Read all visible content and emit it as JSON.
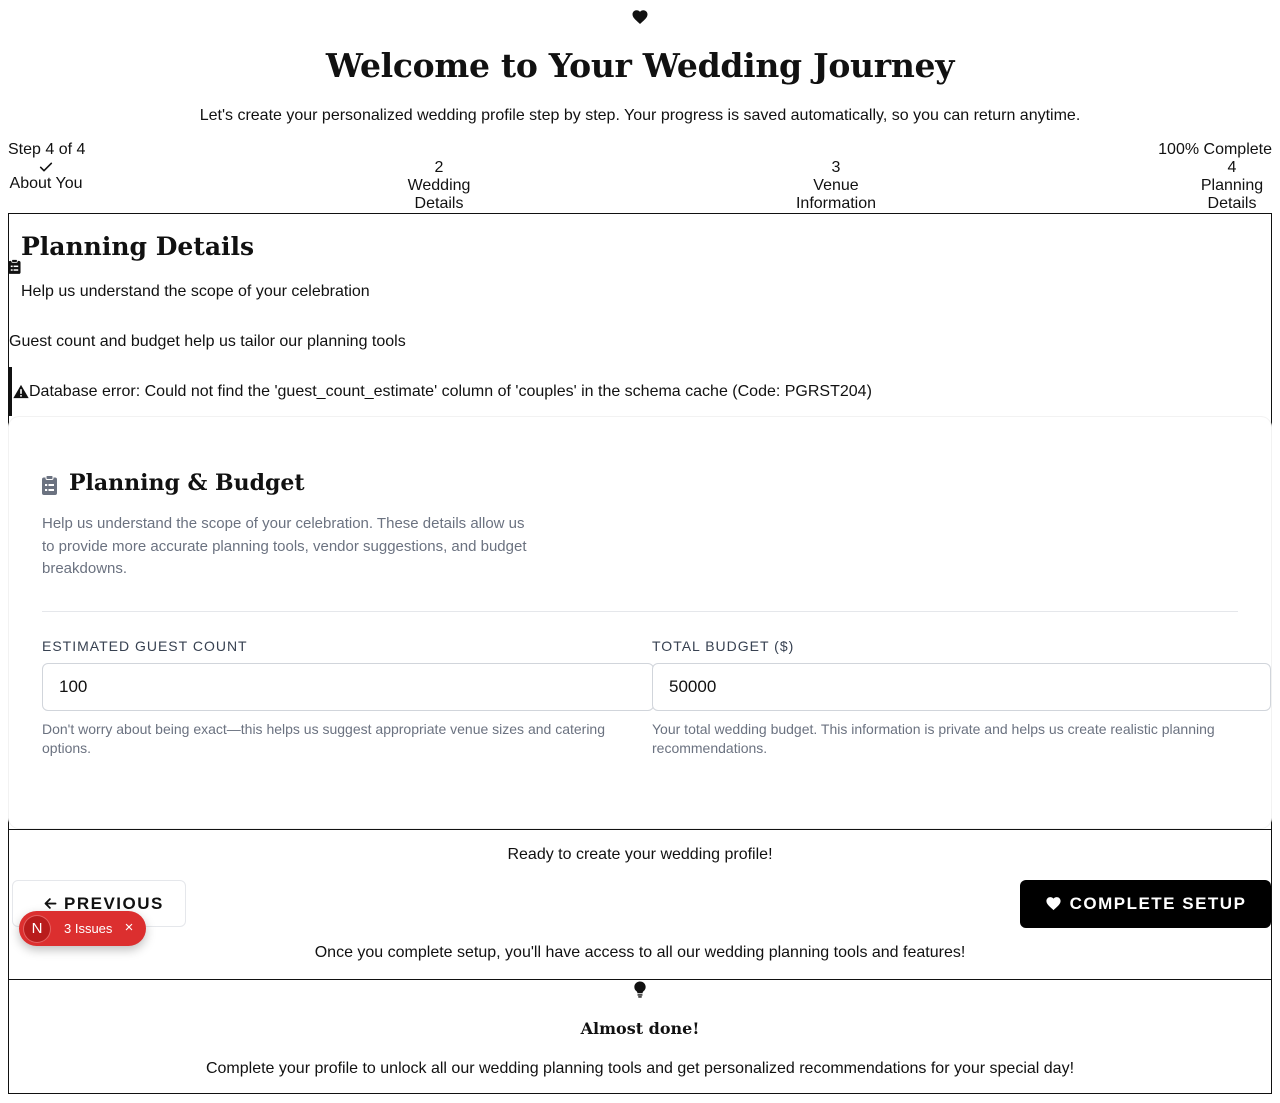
{
  "header": {
    "title": "Welcome to Your Wedding Journey",
    "subtitle": "Let's create your personalized wedding profile step by step. Your progress is saved automatically, so you can return anytime.",
    "icon": "heart-icon"
  },
  "progress": {
    "step_text": "Step 4 of 4",
    "percent_text": "100% Complete",
    "percent": 100,
    "steps": [
      {
        "number": "",
        "label": "About You",
        "completed": true
      },
      {
        "number": "2",
        "label": "Wedding Details"
      },
      {
        "number": "3",
        "label": "Venue Information"
      },
      {
        "number": "4",
        "label": "Planning Details"
      }
    ]
  },
  "section": {
    "title": "Planning Details",
    "subtitle": "Help us understand the scope of your celebration",
    "note": "Guest count and budget help us tailor our planning tools",
    "error": "Database error: Could not find the 'guest_count_estimate' column of 'couples' in the schema cache (Code: PGRST204)"
  },
  "card": {
    "title": "Planning & Budget",
    "description": "Help us understand the scope of your celebration. These details allow us to provide more accurate planning tools, vendor suggestions, and budget breakdowns.",
    "guest_label": "ESTIMATED GUEST COUNT",
    "guest_value": "100",
    "guest_help": "Don't worry about being exact—this helps us suggest appropriate venue sizes and catering options.",
    "budget_label": "TOTAL BUDGET ($)",
    "budget_value": "50000",
    "budget_help": "Your total wedding budget. This information is private and helps us create realistic planning recommendations."
  },
  "nav": {
    "ready_text": "Ready to create your wedding profile!",
    "previous_label": "PREVIOUS",
    "complete_label": "COMPLETE SETUP",
    "once_text": "Once you complete setup, you'll have access to all our wedding planning tools and features!"
  },
  "issues_badge": {
    "initial": "N",
    "text": "3 Issues",
    "close": "×",
    "color": "#dc2f2f"
  },
  "tip": {
    "title": "Almost done!",
    "text": "Complete your profile to unlock all our wedding planning tools and get personalized recommendations for your special day!",
    "icon": "lightbulb-icon"
  }
}
